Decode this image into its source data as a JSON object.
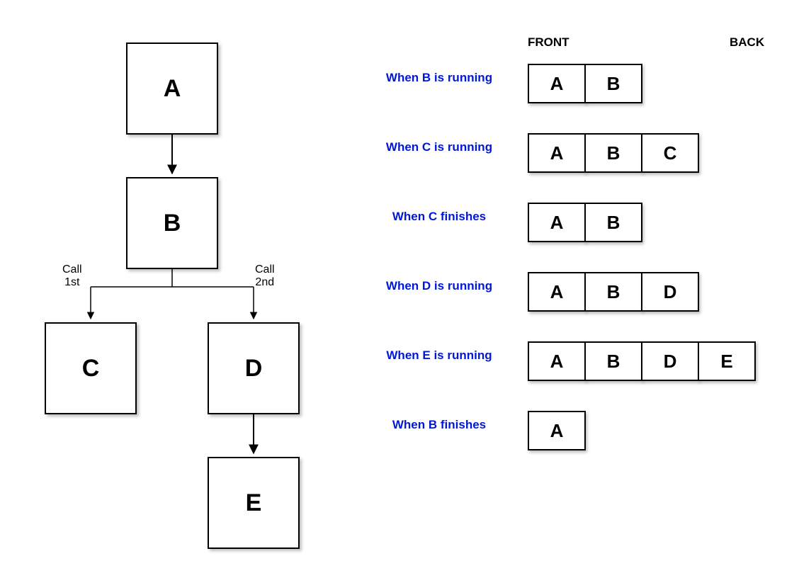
{
  "tree": {
    "nodes": {
      "A": "A",
      "B": "B",
      "C": "C",
      "D": "D",
      "E": "E"
    },
    "edge_labels": {
      "call1": "Call\n1st",
      "call2": "Call\n2nd"
    }
  },
  "headers": {
    "front": "FRONT",
    "back": "BACK"
  },
  "states": [
    {
      "label": "When B is running",
      "stack": [
        "A",
        "B"
      ]
    },
    {
      "label": "When C is running",
      "stack": [
        "A",
        "B",
        "C"
      ]
    },
    {
      "label": "When C finishes",
      "stack": [
        "A",
        "B"
      ]
    },
    {
      "label": "When D is running",
      "stack": [
        "A",
        "B",
        "D"
      ]
    },
    {
      "label": "When E is running",
      "stack": [
        "A",
        "B",
        "D",
        "E"
      ]
    },
    {
      "label": "When B finishes",
      "stack": [
        "A"
      ]
    }
  ],
  "chart_data": {
    "type": "table",
    "title": "Call tree and stack states",
    "tree_edges": [
      [
        "A",
        "B"
      ],
      [
        "B",
        "C"
      ],
      [
        "B",
        "D"
      ],
      [
        "D",
        "E"
      ]
    ],
    "call_order": {
      "B->C": 1,
      "B->D": 2
    },
    "stack_states": [
      {
        "event": "When B is running",
        "stack": [
          "A",
          "B"
        ]
      },
      {
        "event": "When C is running",
        "stack": [
          "A",
          "B",
          "C"
        ]
      },
      {
        "event": "When C finishes",
        "stack": [
          "A",
          "B"
        ]
      },
      {
        "event": "When D is running",
        "stack": [
          "A",
          "B",
          "D"
        ]
      },
      {
        "event": "When E is running",
        "stack": [
          "A",
          "B",
          "D",
          "E"
        ]
      },
      {
        "event": "When B finishes",
        "stack": [
          "A"
        ]
      }
    ]
  }
}
